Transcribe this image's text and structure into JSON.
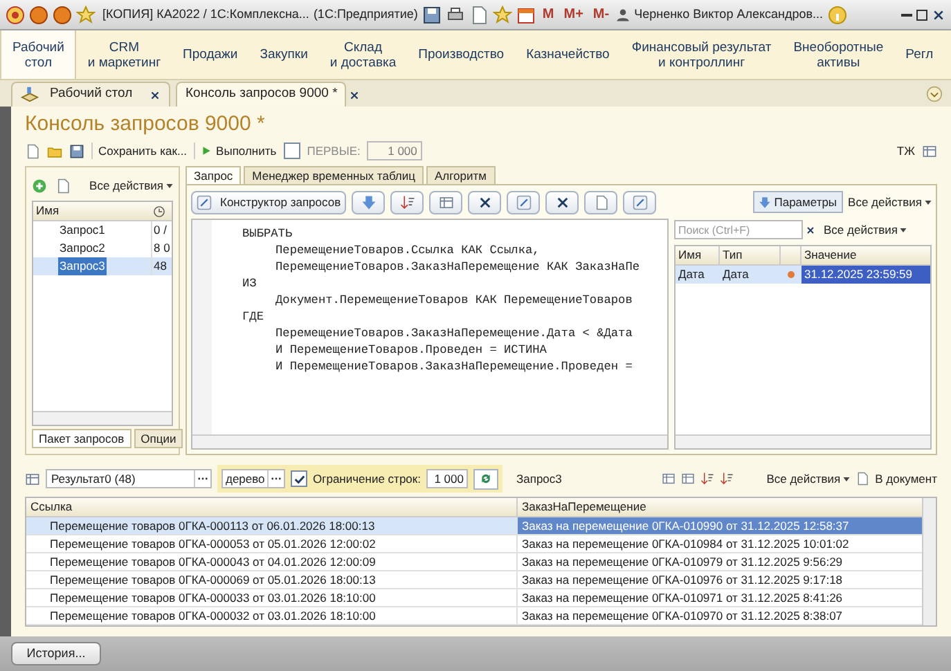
{
  "window": {
    "title": "[КОПИЯ] КА2022 / 1С:Комплексна...",
    "app": "(1С:Предприятие)",
    "user": "Черненко Виктор Александров..."
  },
  "memory_buttons": [
    "M",
    "M+",
    "M-"
  ],
  "sections": [
    {
      "label": "Рабочий стол",
      "selected": true
    },
    {
      "label": "CRM и маркетинг",
      "selected": false
    },
    {
      "label": "Продажи",
      "selected": false
    },
    {
      "label": "Закупки",
      "selected": false
    },
    {
      "label": "Склад и доставка",
      "selected": false
    },
    {
      "label": "Производство",
      "selected": false
    },
    {
      "label": "Казначейство",
      "selected": false
    },
    {
      "label": "Финансовый результат и контроллинг",
      "selected": false
    },
    {
      "label": "Внеоборотные активы",
      "selected": false
    },
    {
      "label": "Регл",
      "selected": false
    }
  ],
  "open_tabs": [
    {
      "label": "Рабочий стол",
      "selected": false
    },
    {
      "label": "Консоль запросов 9000 *",
      "selected": true
    }
  ],
  "form_title": "Консоль запросов 9000 *",
  "toolbar": {
    "save_as": "Сохранить как...",
    "run": "Выполнить",
    "first_label": "ПЕРВЫЕ:",
    "first_checked": false,
    "first_value": "1 000",
    "tj": "ТЖ"
  },
  "queries": {
    "actions": "Все действия",
    "column": "Имя",
    "rows": [
      {
        "name": "Запрос1",
        "value": "0 /",
        "selected": false
      },
      {
        "name": "Запрос2",
        "value": "8 0",
        "selected": false
      },
      {
        "name": "Запрос3",
        "value": "48",
        "selected": true
      }
    ],
    "tabs": [
      {
        "label": "Пакет запросов",
        "selected": true
      },
      {
        "label": "Опции",
        "selected": false
      }
    ]
  },
  "editor_tabs": [
    {
      "label": "Запрос",
      "selected": true
    },
    {
      "label": "Менеджер временных таблиц",
      "selected": false
    },
    {
      "label": "Алгоритм",
      "selected": false
    }
  ],
  "editor": {
    "builder": "Конструктор запросов",
    "clauses": [
      {
        "text": "ВЫБРАТЬ",
        "children": [
          {
            "text": "ПеремещениеТоваров.Ссылка КАК Ссылка,"
          },
          {
            "text": "ПеремещениеТоваров.ЗаказНаПеремещение КАК ЗаказНаПе"
          }
        ]
      },
      {
        "text": "ИЗ",
        "children": [
          {
            "text": "Документ.ПеремещениеТоваров КАК ПеремещениеТоваров"
          }
        ]
      },
      {
        "text": "ГДЕ",
        "children": [
          {
            "text": "ПеремещениеТоваров.ЗаказНаПеремещение.Дата < &Дата"
          },
          {
            "text": "И ПеремещениеТоваров.Проведен = ИСТИНА"
          },
          {
            "text": "И ПеремещениеТоваров.ЗаказНаПеремещение.Проведен ="
          }
        ]
      }
    ]
  },
  "params": {
    "button": "Параметры",
    "actions": "Все действия",
    "search_placeholder": "Поиск (Ctrl+F)",
    "search_actions": "Все действия",
    "columns": [
      "Имя",
      "Тип",
      "Значение"
    ],
    "rows": [
      {
        "name": "Дата",
        "type": "Дата",
        "value": "31.12.2025 23:59:59",
        "selected": true
      }
    ]
  },
  "results": {
    "result": "Результат0 (48)",
    "view": "дерево",
    "limit_label": "Ограничение строк:",
    "limit_checked": true,
    "limit_value": "1 000",
    "query": "Запрос3",
    "actions": "Все действия",
    "to_document": "В документ",
    "columns": [
      "Ссылка",
      "ЗаказНаПеремещение"
    ],
    "rows": [
      {
        "cells": [
          "Перемещение товаров 0ГКА-000113 от 06.01.2026 18:00:13",
          "Заказ на перемещение 0ГКА-010990 от 31.12.2025 12:58:37"
        ],
        "selected": true
      },
      {
        "cells": [
          "Перемещение товаров 0ГКА-000053 от 05.01.2026 12:00:02",
          "Заказ на перемещение 0ГКА-010984 от 31.12.2025 10:01:02"
        ],
        "selected": false
      },
      {
        "cells": [
          "Перемещение товаров 0ГКА-000043 от 04.01.2026 12:00:09",
          "Заказ на перемещение 0ГКА-010979 от 31.12.2025 9:56:29"
        ],
        "selected": false
      },
      {
        "cells": [
          "Перемещение товаров 0ГКА-000069 от 05.01.2026 18:00:13",
          "Заказ на перемещение 0ГКА-010976 от 31.12.2025 9:17:18"
        ],
        "selected": false
      },
      {
        "cells": [
          "Перемещение товаров 0ГКА-000033 от 03.01.2026 18:10:00",
          "Заказ на перемещение 0ГКА-010971 от 31.12.2025 8:41:26"
        ],
        "selected": false
      },
      {
        "cells": [
          "Перемещение товаров 0ГКА-000032 от 03.01.2026 18:10:00",
          "Заказ на перемещение 0ГКА-010970 от 31.12.2025 8:38:07"
        ],
        "selected": false
      }
    ]
  },
  "history_button": "История..."
}
